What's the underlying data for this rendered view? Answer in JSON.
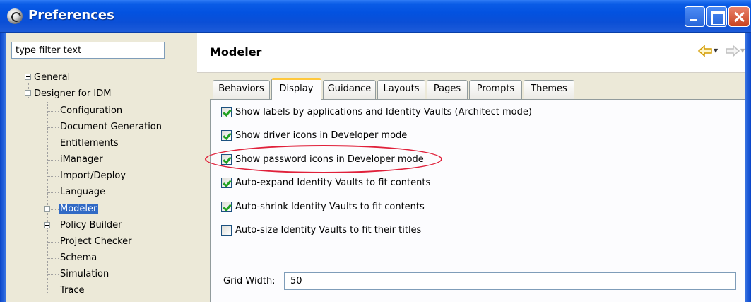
{
  "window": {
    "title": "Preferences"
  },
  "filter": {
    "value": "type filter text"
  },
  "tree": {
    "general": "General",
    "designer": "Designer for IDM",
    "children": [
      "Configuration",
      "Document Generation",
      "Entitlements",
      "iManager",
      "Import/Deploy",
      "Language",
      "Modeler",
      "Policy Builder",
      "Project Checker",
      "Schema",
      "Simulation",
      "Trace"
    ],
    "selected": "Modeler"
  },
  "page": {
    "title": "Modeler"
  },
  "tabs": [
    "Behaviors",
    "Display",
    "Guidance",
    "Layouts",
    "Pages",
    "Prompts",
    "Themes"
  ],
  "active_tab": "Display",
  "options": [
    {
      "label": "Show labels by applications and Identity Vaults (Architect mode)",
      "checked": true
    },
    {
      "label": "Show driver icons in Developer mode",
      "checked": true
    },
    {
      "label": "Show password icons in Developer mode",
      "checked": true
    },
    {
      "label": "Auto-expand Identity Vaults to fit contents",
      "checked": true
    },
    {
      "label": "Auto-shrink Identity Vaults to fit contents",
      "checked": true
    },
    {
      "label": "Auto-size Identity Vaults to fit their titles",
      "checked": false
    }
  ],
  "grid": {
    "label": "Grid Width:",
    "value": "50"
  },
  "icons": {
    "app": "yin-yang-icon",
    "back": "arrow-left-icon",
    "forward": "arrow-right-icon"
  },
  "colors": {
    "titlebar": "#0352e0",
    "selection": "#316ac5",
    "active_tab_accent": "#ffc83c",
    "highlight": "#e0203a"
  }
}
